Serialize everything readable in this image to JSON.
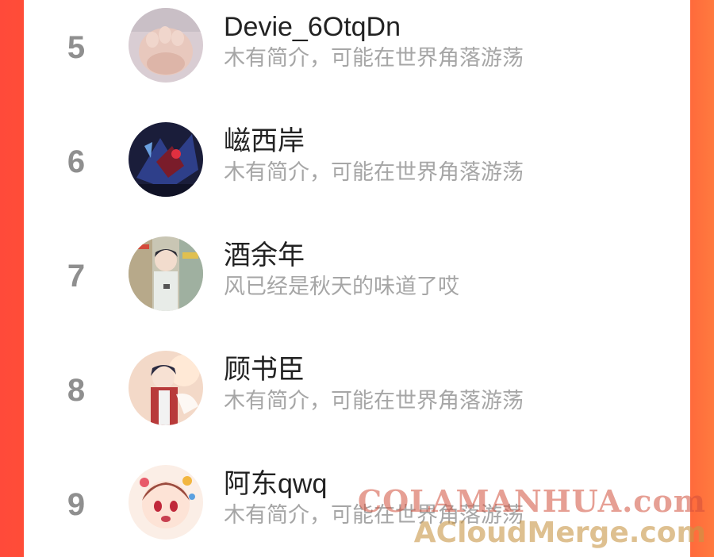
{
  "ranking": [
    {
      "rank": "5",
      "name": "Devie_6OtqDn",
      "bio": "木有简介，可能在世界角落游荡",
      "avatar": "feet-photo-avatar"
    },
    {
      "rank": "6",
      "name": "嵫西岸",
      "bio": "木有简介，可能在世界角落游荡",
      "avatar": "mecha-art-avatar"
    },
    {
      "rank": "7",
      "name": "酒余年",
      "bio": "风已经是秋天的味道了哎",
      "avatar": "anime-boy-avatar"
    },
    {
      "rank": "8",
      "name": "顾书臣",
      "bio": "木有简介，可能在世界角落游荡",
      "avatar": "anime-boy-red-avatar"
    },
    {
      "rank": "9",
      "name": "阿东qwq",
      "bio": "木有简介，可能在世界角落游荡",
      "avatar": "chibi-girl-avatar"
    }
  ],
  "watermark": {
    "line1": "COLAMANHUA.com",
    "line2": "ACloudMerge.com"
  },
  "colors": {
    "accent": "#ff5a3a",
    "rank": "#8f8f8f",
    "name": "#222222",
    "bio": "#a6a6a6"
  }
}
